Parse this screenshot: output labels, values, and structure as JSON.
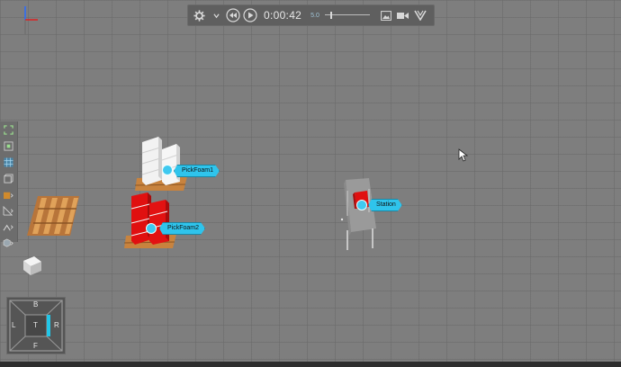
{
  "playback": {
    "time": "0:00:42",
    "speed": "5.0"
  },
  "objects": [
    {
      "label": "PickFoam1"
    },
    {
      "label": "PickFoam2"
    },
    {
      "label": "Station"
    }
  ],
  "view_cube": {
    "back": "B",
    "left": "L",
    "top": "T",
    "right": "R",
    "front": "F"
  },
  "colors": {
    "floor": "#7e7e7e",
    "label_fill": "#2fc4ec",
    "foam_red": "#e01010",
    "foam_white": "#eeeeee",
    "pallet": "#c8833e",
    "axis_red": "#d22",
    "axis_blue": "#2a6cff",
    "cube_highlight": "#22c6e8"
  }
}
